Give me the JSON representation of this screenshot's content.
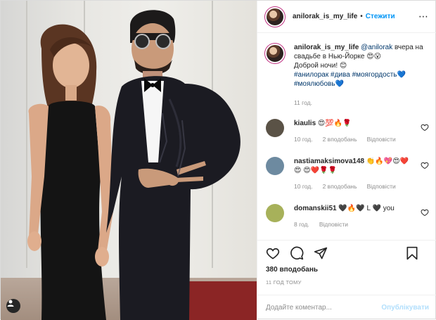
{
  "post": {
    "username": "anilorak_is_my_life",
    "dot": "•",
    "follow_label": "Стежити",
    "more_icon": "⋯",
    "photo_user_tag_icon": "user-tag-icon"
  },
  "caption": {
    "username": "anilorak_is_my_life",
    "mention": "@anilorak",
    "text_1": " вчера на свадьбе в Нью-Йорке 😍😮",
    "text_2": "Доброй ночи! 😊",
    "hashtag_1": "#анилорак",
    "hashtag_2": "#дива",
    "hashtag_3": "#моягордость💙",
    "hashtag_4": "#моялюбовь💙",
    "age": "11 год."
  },
  "comments": [
    {
      "username": "kiaulis",
      "text": "😍💯🔥🌹",
      "age": "10 год.",
      "likes": "2 вподобань",
      "reply": "Відповісти",
      "avatar_color": "#5a5246"
    },
    {
      "username": "nastiamaksimova148",
      "text": "👏🔥💖😍❤️😍 😍❤️🌹🌹",
      "age": "10 год.",
      "likes": "2 вподобань",
      "reply": "Відповісти",
      "avatar_color": "#6d8aa0"
    },
    {
      "username": "domanskii51",
      "text": "🖤🔥🖤 L 🖤 you",
      "age": "8 год.",
      "likes": "",
      "reply": "Відповісти",
      "avatar_color": "#a7b15a"
    }
  ],
  "actions": {
    "likes": "380 вподобань",
    "time": "11 ГОД ТОМУ"
  },
  "add_comment": {
    "placeholder": "Додайте коментар...",
    "post_label": "Опублікувати"
  },
  "colors": {
    "accent": "#0095f6",
    "hashtag": "#00376b",
    "muted": "#8e8e8e",
    "post_disabled": "#b2dffc"
  }
}
